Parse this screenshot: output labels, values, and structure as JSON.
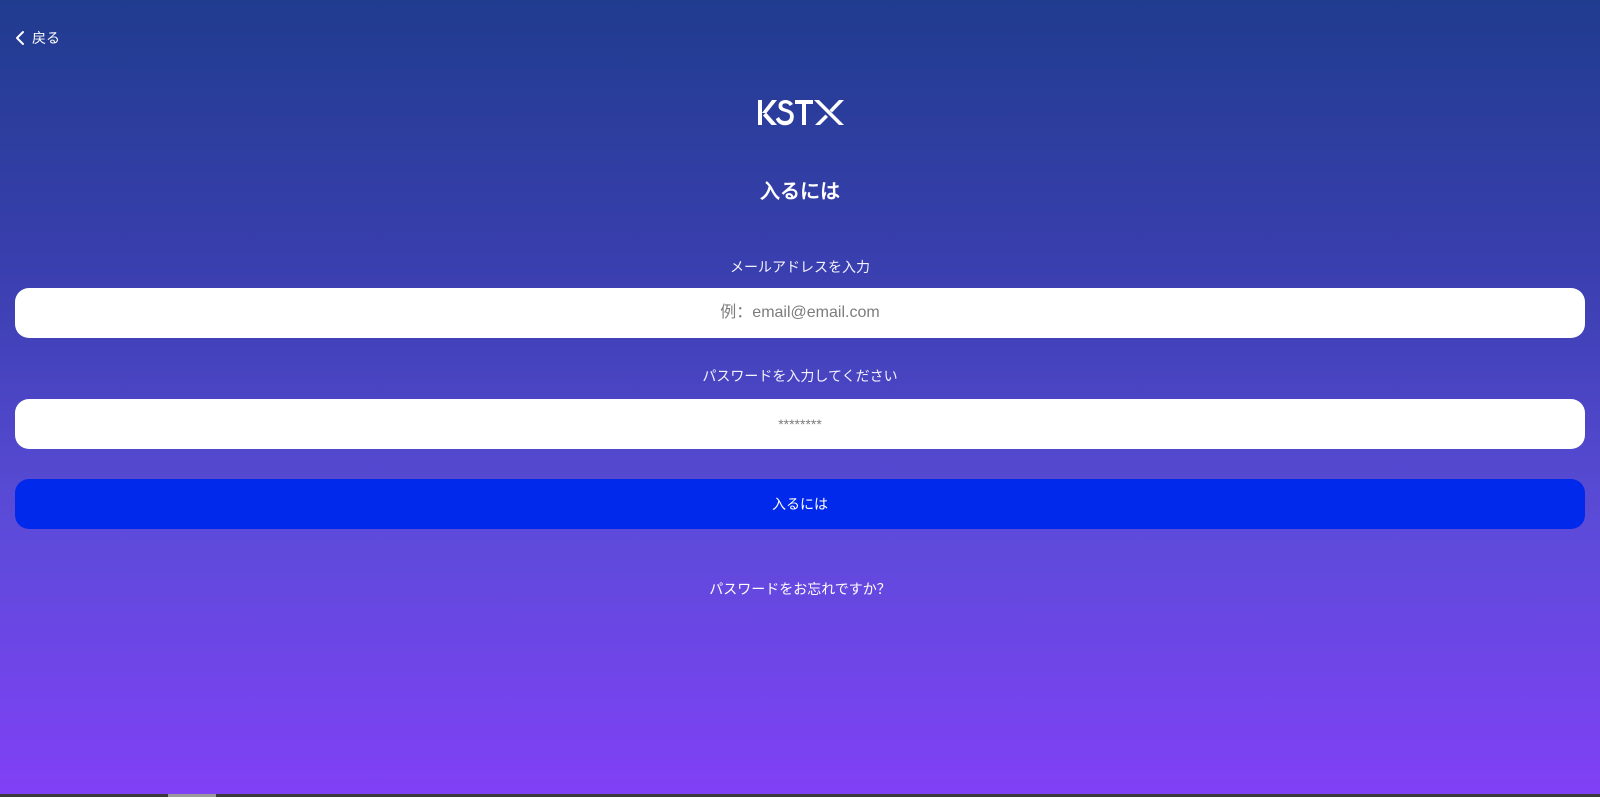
{
  "nav": {
    "back_label": "戻る"
  },
  "logo": {
    "text": "KSTX"
  },
  "page": {
    "title": "入るには"
  },
  "form": {
    "email_label": "メールアドレスを入力",
    "email_placeholder": "例：email@email.com",
    "email_value": "",
    "password_label": "パスワードを入力してください",
    "password_placeholder": "********",
    "password_value": "",
    "submit_label": "入るには",
    "forgot_password_label": "パスワードをお忘れですか？"
  },
  "colors": {
    "gradient_top": "#203c8f",
    "gradient_bottom": "#8140f6",
    "button": "#0029ec",
    "input_background": "#ffffff"
  }
}
